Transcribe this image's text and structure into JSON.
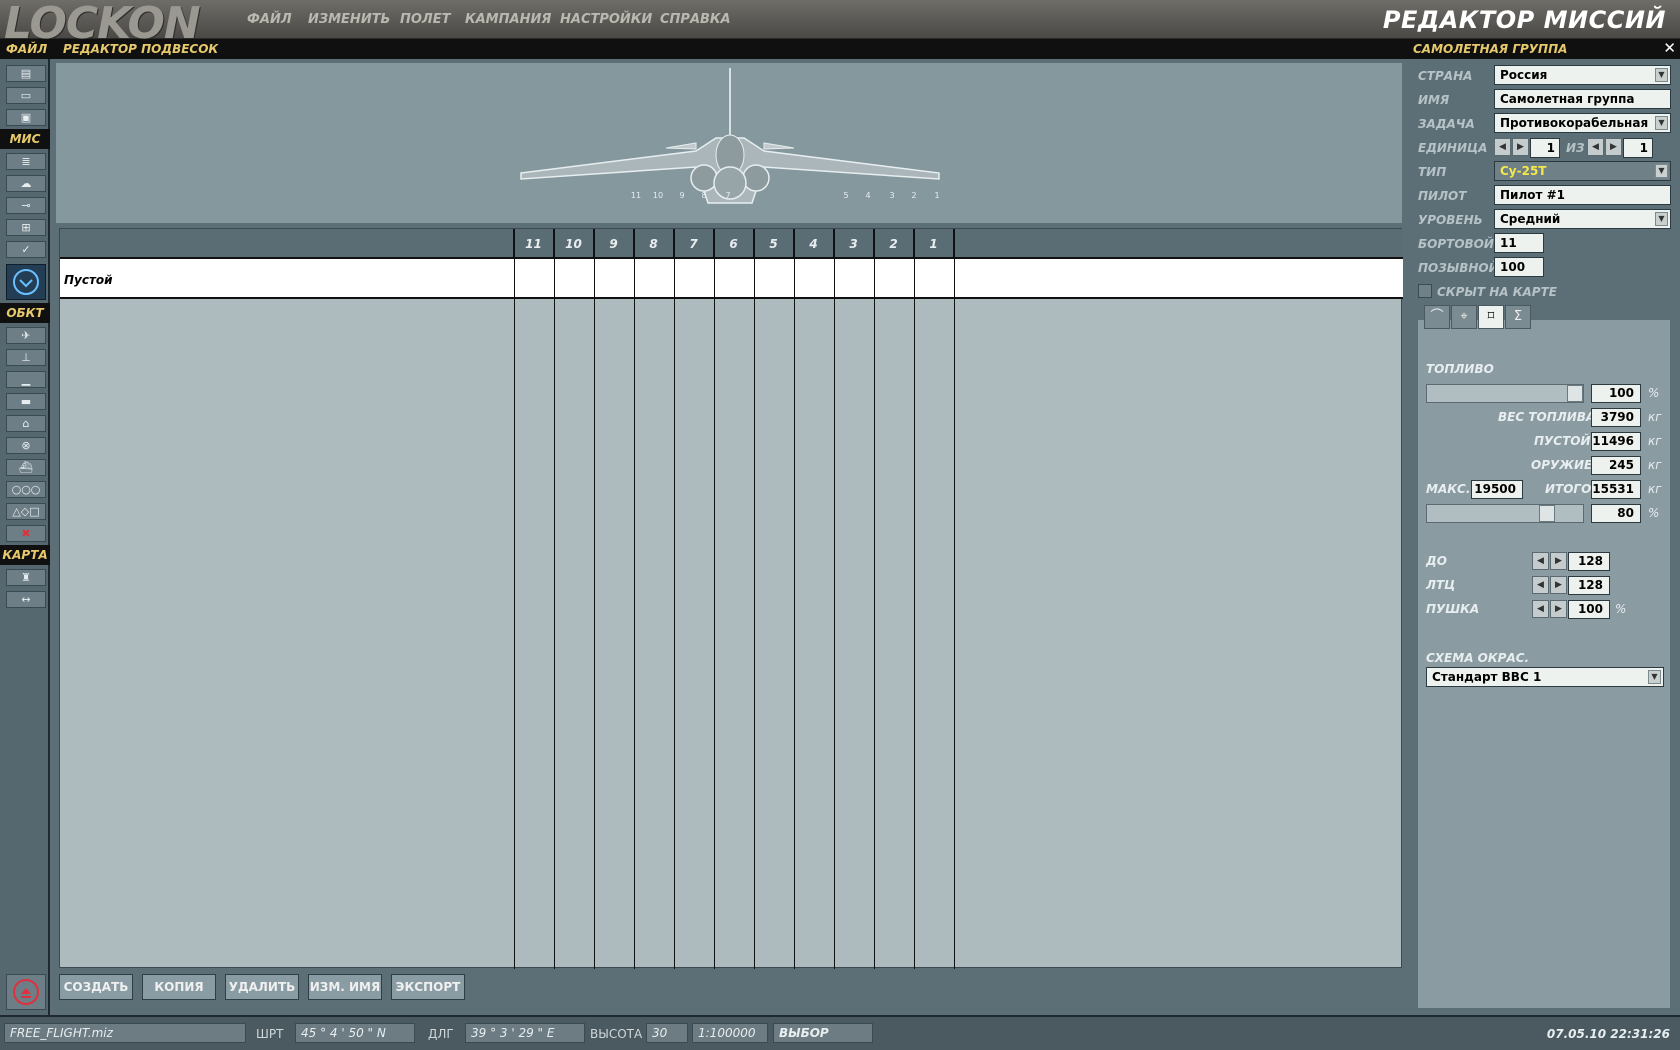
{
  "app": {
    "logo": "LOCKON",
    "title": "РЕДАКТОР МИССИЙ"
  },
  "menu": [
    "ФАЙЛ",
    "ИЗМЕНИТЬ",
    "ПОЛЕТ",
    "КАМПАНИЯ",
    "НАСТРОЙКИ",
    "СПРАВКА"
  ],
  "headers": {
    "left": "ФАЙЛ",
    "center": "РЕДАКТОР ПОДВЕСОК",
    "right": "САМОЛЕТНАЯ ГРУППА",
    "close": "✕"
  },
  "sidebar": {
    "sections": [
      "ФАЙЛ",
      "МИС",
      "ОБКТ",
      "КАРТА"
    ],
    "file_buttons": [
      "new-file-icon",
      "open-folder-icon",
      "save-icon"
    ],
    "mis_buttons": [
      "briefing-icon",
      "weather-icon",
      "goals-icon",
      "triggers-icon",
      "check-icon"
    ],
    "obj_buttons": [
      "plane-icon",
      "helicopter-icon",
      "ship-icon",
      "vehicle-icon",
      "static-icon",
      "airfield-icon",
      "carrier-icon",
      "group-icon",
      "shapes-icon",
      "delete-icon"
    ],
    "map_buttons": [
      "binoculars-icon",
      "ruler-icon"
    ]
  },
  "aircraft": {
    "pylons": [
      "11",
      "10",
      "9",
      "8",
      "7",
      "6",
      "5",
      "4",
      "3",
      "2",
      "1"
    ]
  },
  "table": {
    "columns": [
      "11",
      "10",
      "9",
      "8",
      "7",
      "6",
      "5",
      "4",
      "3",
      "2",
      "1"
    ],
    "rows": [
      {
        "name": "Пустой"
      }
    ]
  },
  "buttons": [
    "СОЗДАТЬ",
    "КОПИЯ",
    "УДАЛИТЬ",
    "ИЗМ. ИМЯ",
    "ЭКСПОРТ"
  ],
  "group": {
    "country_label": "СТРАНА",
    "country": "Россия",
    "name_label": "ИМЯ",
    "name": "Самолетная группа",
    "task_label": "ЗАДАЧА",
    "task": "Противокорабельная",
    "unit_label": "ЕДИНИЦА",
    "unit": "1",
    "of_label": "ИЗ",
    "of": "1",
    "type_label": "ТИП",
    "type": "Су-25T",
    "pilot_label": "ПИЛОТ",
    "pilot": "Пилот #1",
    "level_label": "УРОВЕНЬ",
    "level": "Средний",
    "board_label": "БОРТОВОЙ",
    "board": "11",
    "callsign_label": "ПОЗЫВНОЙ",
    "callsign": "100",
    "hidden_label": "СКРЫТ НА КАРТЕ"
  },
  "tabs": [
    "route-icon",
    "targets-icon",
    "payload-icon",
    "summary-icon"
  ],
  "payload": {
    "fuel_label": "ТОПЛИВО",
    "fuel_percent": "100",
    "fuel_slider": 1.0,
    "percent": "%",
    "fuel_weight_label": "ВЕС ТОПЛИВА",
    "fuel_weight": "3790",
    "empty_label": "ПУСТОЙ",
    "empty": "11496",
    "weapons_label": "ОРУЖИЕ",
    "weapons": "245",
    "max_label": "МАКС.",
    "max": "19500",
    "total_label": "ИТОГО",
    "total": "15531",
    "total_percent": "80",
    "total_slider": 0.8,
    "kg": "кг",
    "chaff_label": "ДО",
    "chaff": "128",
    "flare_label": "ЛТЦ",
    "flare": "128",
    "gun_label": "ПУШКА",
    "gun": "100",
    "livery_label": "СХЕМА ОКРАС.",
    "livery": "Стандарт ВВС 1"
  },
  "status": {
    "file": "FREE_FLIGHT.miz",
    "lat_label": "ШРТ",
    "lat": "45 ° 4   '  50 \"  N",
    "lon_label": "ДЛГ",
    "lon": "39 ° 3   '  29 \"  E",
    "alt_label": "ВЫСОТА",
    "alt": "30",
    "scale": "1:100000",
    "mode": "ВЫБОР",
    "datetime": "07.05.10 22:31:26"
  }
}
